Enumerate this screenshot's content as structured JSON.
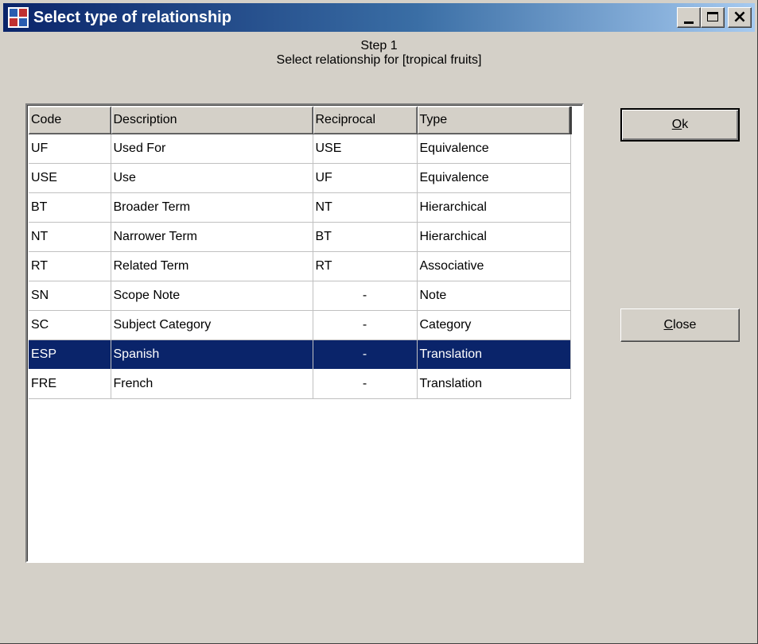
{
  "window": {
    "title": "Select type of relationship"
  },
  "header": {
    "step_title": "Step 1",
    "step_subtitle": "Select relationship for [tropical fruits]"
  },
  "table": {
    "columns": [
      "Code",
      "Description",
      "Reciprocal",
      "Type"
    ],
    "selected_index": 7,
    "rows": [
      [
        "UF",
        "Used For",
        "USE",
        "Equivalence"
      ],
      [
        "USE",
        "Use",
        "UF",
        "Equivalence"
      ],
      [
        "BT",
        "Broader Term",
        "NT",
        "Hierarchical"
      ],
      [
        "NT",
        "Narrower Term",
        "BT",
        "Hierarchical"
      ],
      [
        "RT",
        "Related Term",
        "RT",
        "Associative"
      ],
      [
        "SN",
        "Scope Note",
        "-",
        "Note"
      ],
      [
        "SC",
        "Subject Category",
        "-",
        "Category"
      ],
      [
        "ESP",
        "Spanish",
        "-",
        "Translation"
      ],
      [
        "FRE",
        "French",
        "-",
        "Translation"
      ]
    ]
  },
  "buttons": {
    "ok": {
      "mnemonic": "O",
      "rest": "k"
    },
    "close": {
      "mnemonic": "C",
      "rest": "lose"
    }
  },
  "colors": {
    "titlebar_start": "#0a246a",
    "titlebar_end": "#a6caf0",
    "selection": "#0a246a",
    "window_bg": "#d4d0c8"
  }
}
